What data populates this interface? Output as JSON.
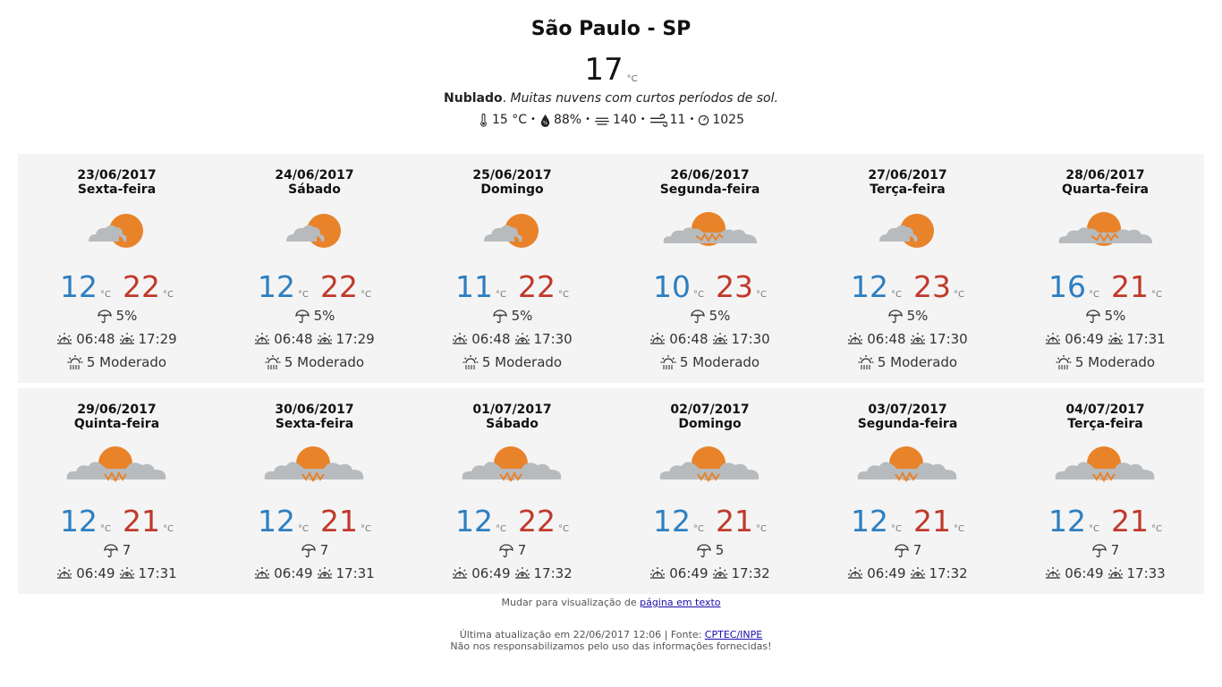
{
  "city": "São Paulo - SP",
  "current": {
    "temp": "17",
    "unit": "°C",
    "condition": "Nublado",
    "description": "Muitas nuvens com curtos períodos de sol.",
    "feels": "15 °C",
    "humidity": "88%",
    "wind_dir": "140",
    "wind_speed": "11",
    "pressure": "1025"
  },
  "units": {
    "c": "°C"
  },
  "days": [
    {
      "date": "23/06/2017",
      "weekday": "Sexta-feira",
      "icon": "partly-cloudy",
      "min": "12",
      "max": "22",
      "rain": "5%",
      "sunrise": "06:48",
      "sunset": "17:29",
      "uv": "5 Moderado"
    },
    {
      "date": "24/06/2017",
      "weekday": "Sábado",
      "icon": "partly-cloudy",
      "min": "12",
      "max": "22",
      "rain": "5%",
      "sunrise": "06:48",
      "sunset": "17:29",
      "uv": "5 Moderado"
    },
    {
      "date": "25/06/2017",
      "weekday": "Domingo",
      "icon": "partly-cloudy",
      "min": "11",
      "max": "22",
      "rain": "5%",
      "sunrise": "06:48",
      "sunset": "17:30",
      "uv": "5 Moderado"
    },
    {
      "date": "26/06/2017",
      "weekday": "Segunda-feira",
      "icon": "cloudy-sun",
      "min": "10",
      "max": "23",
      "rain": "5%",
      "sunrise": "06:48",
      "sunset": "17:30",
      "uv": "5 Moderado"
    },
    {
      "date": "27/06/2017",
      "weekday": "Terça-feira",
      "icon": "partly-cloudy",
      "min": "12",
      "max": "23",
      "rain": "5%",
      "sunrise": "06:48",
      "sunset": "17:30",
      "uv": "5 Moderado"
    },
    {
      "date": "28/06/2017",
      "weekday": "Quarta-feira",
      "icon": "cloudy-sun",
      "min": "16",
      "max": "21",
      "rain": "5%",
      "sunrise": "06:49",
      "sunset": "17:31",
      "uv": "5 Moderado"
    },
    {
      "date": "29/06/2017",
      "weekday": "Quinta-feira",
      "icon": "cloudy-sun-large",
      "min": "12",
      "max": "21",
      "rain": "7",
      "sunrise": "06:49",
      "sunset": "17:31"
    },
    {
      "date": "30/06/2017",
      "weekday": "Sexta-feira",
      "icon": "cloudy-sun-large",
      "min": "12",
      "max": "21",
      "rain": "7",
      "sunrise": "06:49",
      "sunset": "17:31"
    },
    {
      "date": "01/07/2017",
      "weekday": "Sábado",
      "icon": "cloudy-sun-large",
      "min": "12",
      "max": "22",
      "rain": "7",
      "sunrise": "06:49",
      "sunset": "17:32"
    },
    {
      "date": "02/07/2017",
      "weekday": "Domingo",
      "icon": "cloudy-sun-large",
      "min": "12",
      "max": "21",
      "rain": "5",
      "sunrise": "06:49",
      "sunset": "17:32"
    },
    {
      "date": "03/07/2017",
      "weekday": "Segunda-feira",
      "icon": "cloudy-sun-large",
      "min": "12",
      "max": "21",
      "rain": "7",
      "sunrise": "06:49",
      "sunset": "17:32"
    },
    {
      "date": "04/07/2017",
      "weekday": "Terça-feira",
      "icon": "cloudy-sun-large",
      "min": "12",
      "max": "21",
      "rain": "7",
      "sunrise": "06:49",
      "sunset": "17:33"
    }
  ],
  "footer": {
    "switch_prefix": "Mudar para visualização de ",
    "switch_link": "página em texto",
    "updated_prefix": "Última atualização em 22/06/2017 12:06 | Fonte: ",
    "source_link": "CPTEC/INPE",
    "disclaimer": "Não nos responsabilizamos pelo uso das informações fornecidas!"
  },
  "colors": {
    "min": "#2d7fc1",
    "max": "#c0392b",
    "sun": "#e8832a",
    "cloud": "#b8bbbe",
    "panel": "#f4f4f4"
  }
}
